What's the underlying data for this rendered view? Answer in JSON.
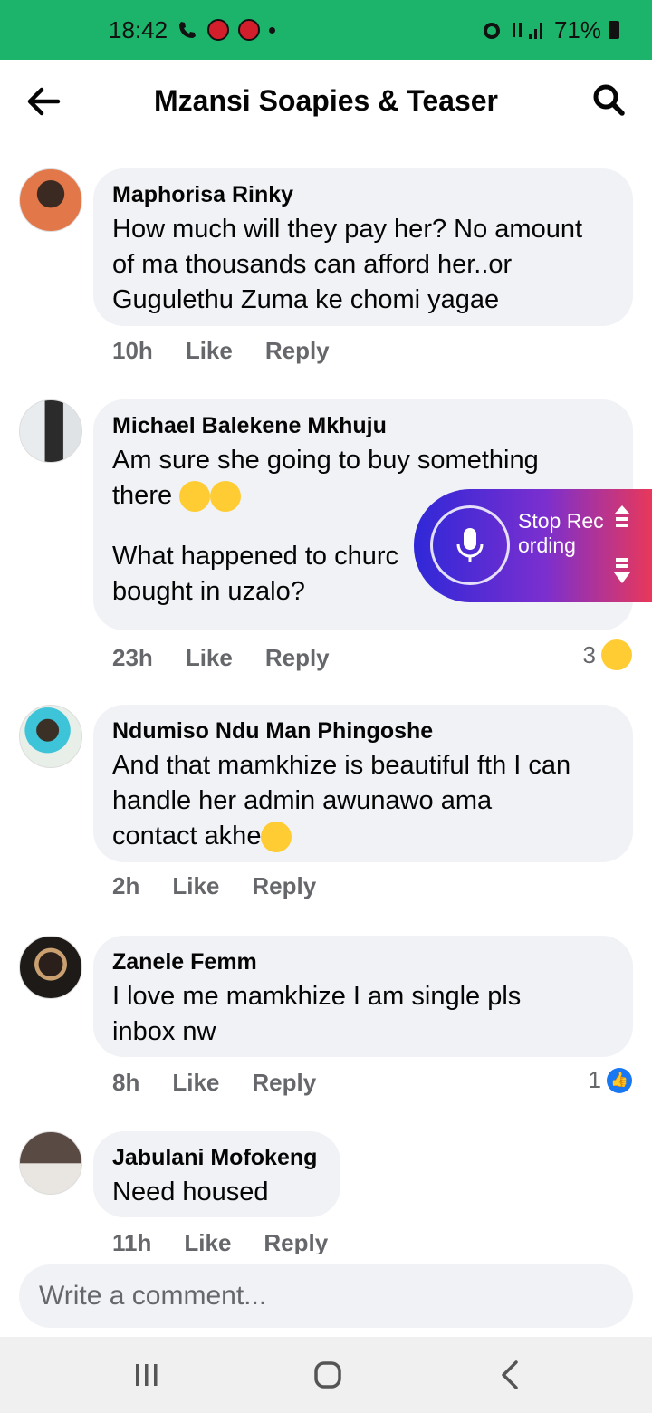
{
  "status_bar": {
    "time": "18:42",
    "battery": "71%"
  },
  "header": {
    "title": "Mzansi Soapies & Teaser"
  },
  "comments": [
    {
      "name": "Maphorisa Rinky",
      "text": "How much will they pay her? No amount\nof ma thousands can afford her..or\nGugulethu Zuma ke chomi yagae",
      "time": "10h",
      "like": "Like",
      "reply": "Reply"
    },
    {
      "name": "Michael Balekene Mkhuju",
      "text": "Am sure she going to buy something\nthere",
      "text2": "What happened to churc\nbought in uzalo?",
      "time": "23h",
      "like": "Like",
      "reply": "Reply",
      "reaction_count": "3"
    },
    {
      "name": "Ndumiso Ndu Man Phingoshe",
      "text": "And that mamkhize is beautiful fth I can\nhandle her admin awunawo ama\ncontact akhe",
      "time": "2h",
      "like": "Like",
      "reply": "Reply"
    },
    {
      "name": "Zanele Femm",
      "text": "I love me mamkhize I am single pls\ninbox nw",
      "time": "8h",
      "like": "Like",
      "reply": "Reply",
      "reaction_count": "1"
    },
    {
      "name": "Jabulani Mofokeng",
      "text": "Need housed",
      "time": "11h",
      "like": "Like",
      "reply": "Reply"
    }
  ],
  "recorder": {
    "label": "Stop Recording"
  },
  "composer": {
    "placeholder": "Write a comment..."
  },
  "colors": {
    "status_bar": "#1cb46b",
    "bubble": "#f0f2f5",
    "meta": "#65676b",
    "like_blue": "#1877f2"
  }
}
